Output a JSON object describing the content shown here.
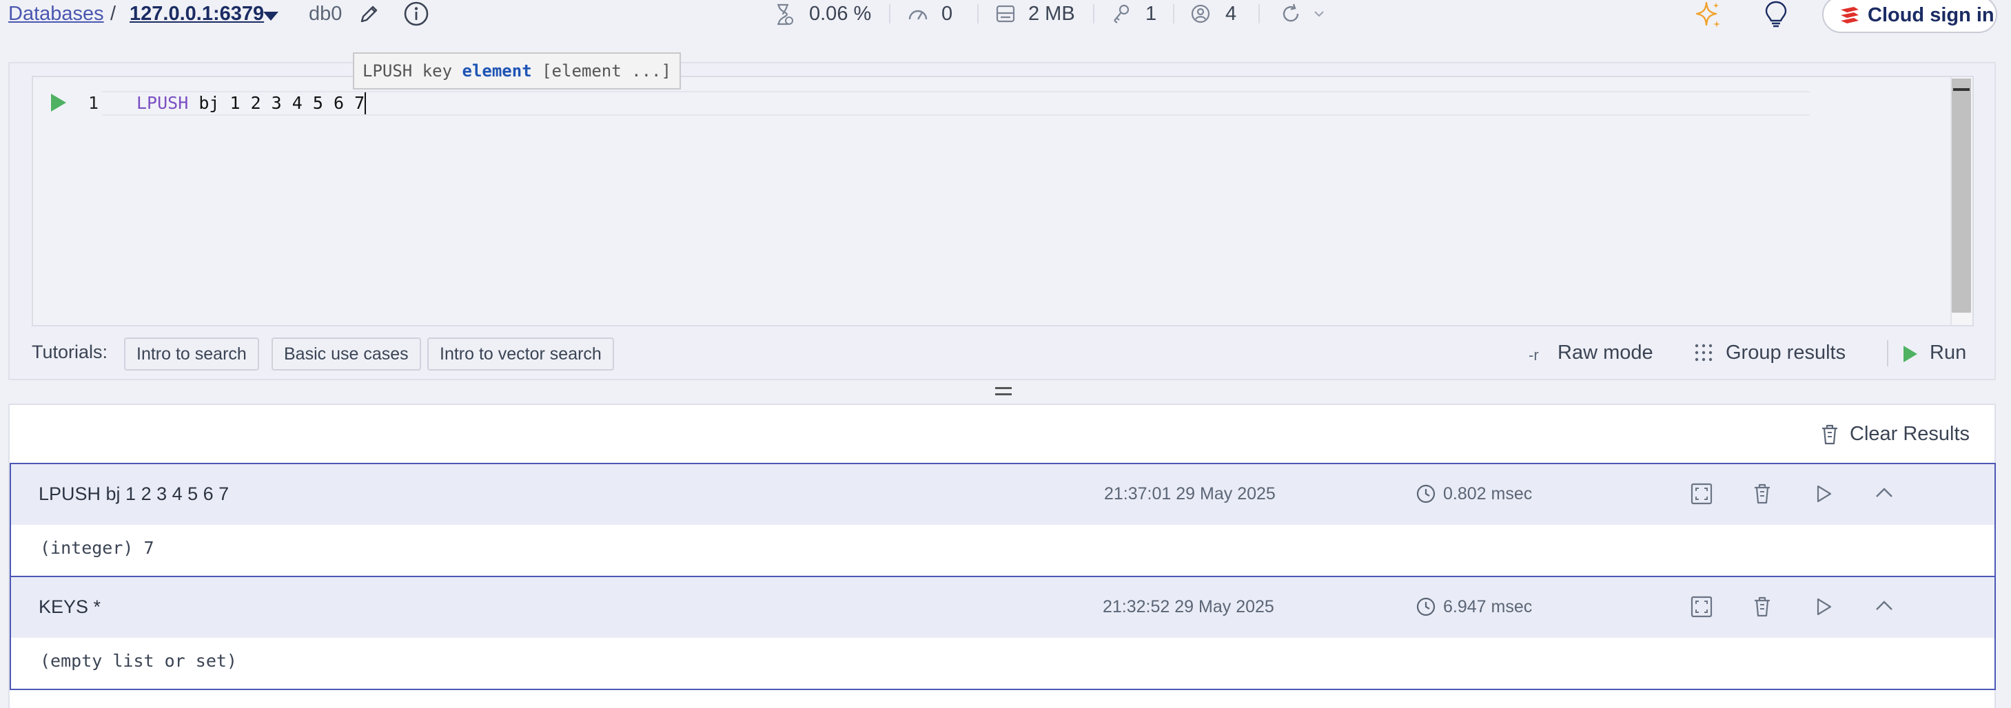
{
  "header": {
    "breadcrumb_root": "Databases",
    "separator": "/",
    "host": "127.0.0.1:6379",
    "db": "db0",
    "stats": {
      "cpu": "0.06 %",
      "ops": "0",
      "memory": "2 MB",
      "keys": "1",
      "clients": "4"
    },
    "cloud_sign_in": "Cloud sign in"
  },
  "editor": {
    "line_number": "1",
    "command_keyword": "LPUSH",
    "command_args": " bj 1 2 3 4 5 6 7",
    "hint_prefix": "LPUSH key ",
    "hint_bold": "element",
    "hint_suffix": " [element ...]"
  },
  "tutorials": {
    "label": "Tutorials:",
    "buttons": [
      "Intro to search",
      "Basic use cases",
      "Intro to vector search"
    ]
  },
  "toolbar": {
    "raw_mode_flag": "-r",
    "raw_mode": "Raw mode",
    "group_results": "Group results",
    "run": "Run"
  },
  "results": {
    "clear_label": "Clear Results",
    "items": [
      {
        "command": "LPUSH bj 1 2 3 4 5 6 7",
        "timestamp": "21:37:01 29 May 2025",
        "duration": "0.802 msec",
        "output": "(integer) 7"
      },
      {
        "command": "KEYS *",
        "timestamp": "21:32:52 29 May 2025",
        "duration": "6.947 msec",
        "output": "(empty list or set)"
      }
    ]
  },
  "colors": {
    "accent": "#4b57b6",
    "run_green": "#4fb263",
    "cloud_red": "#e0302a",
    "ai_orange": "#f1a22e"
  }
}
